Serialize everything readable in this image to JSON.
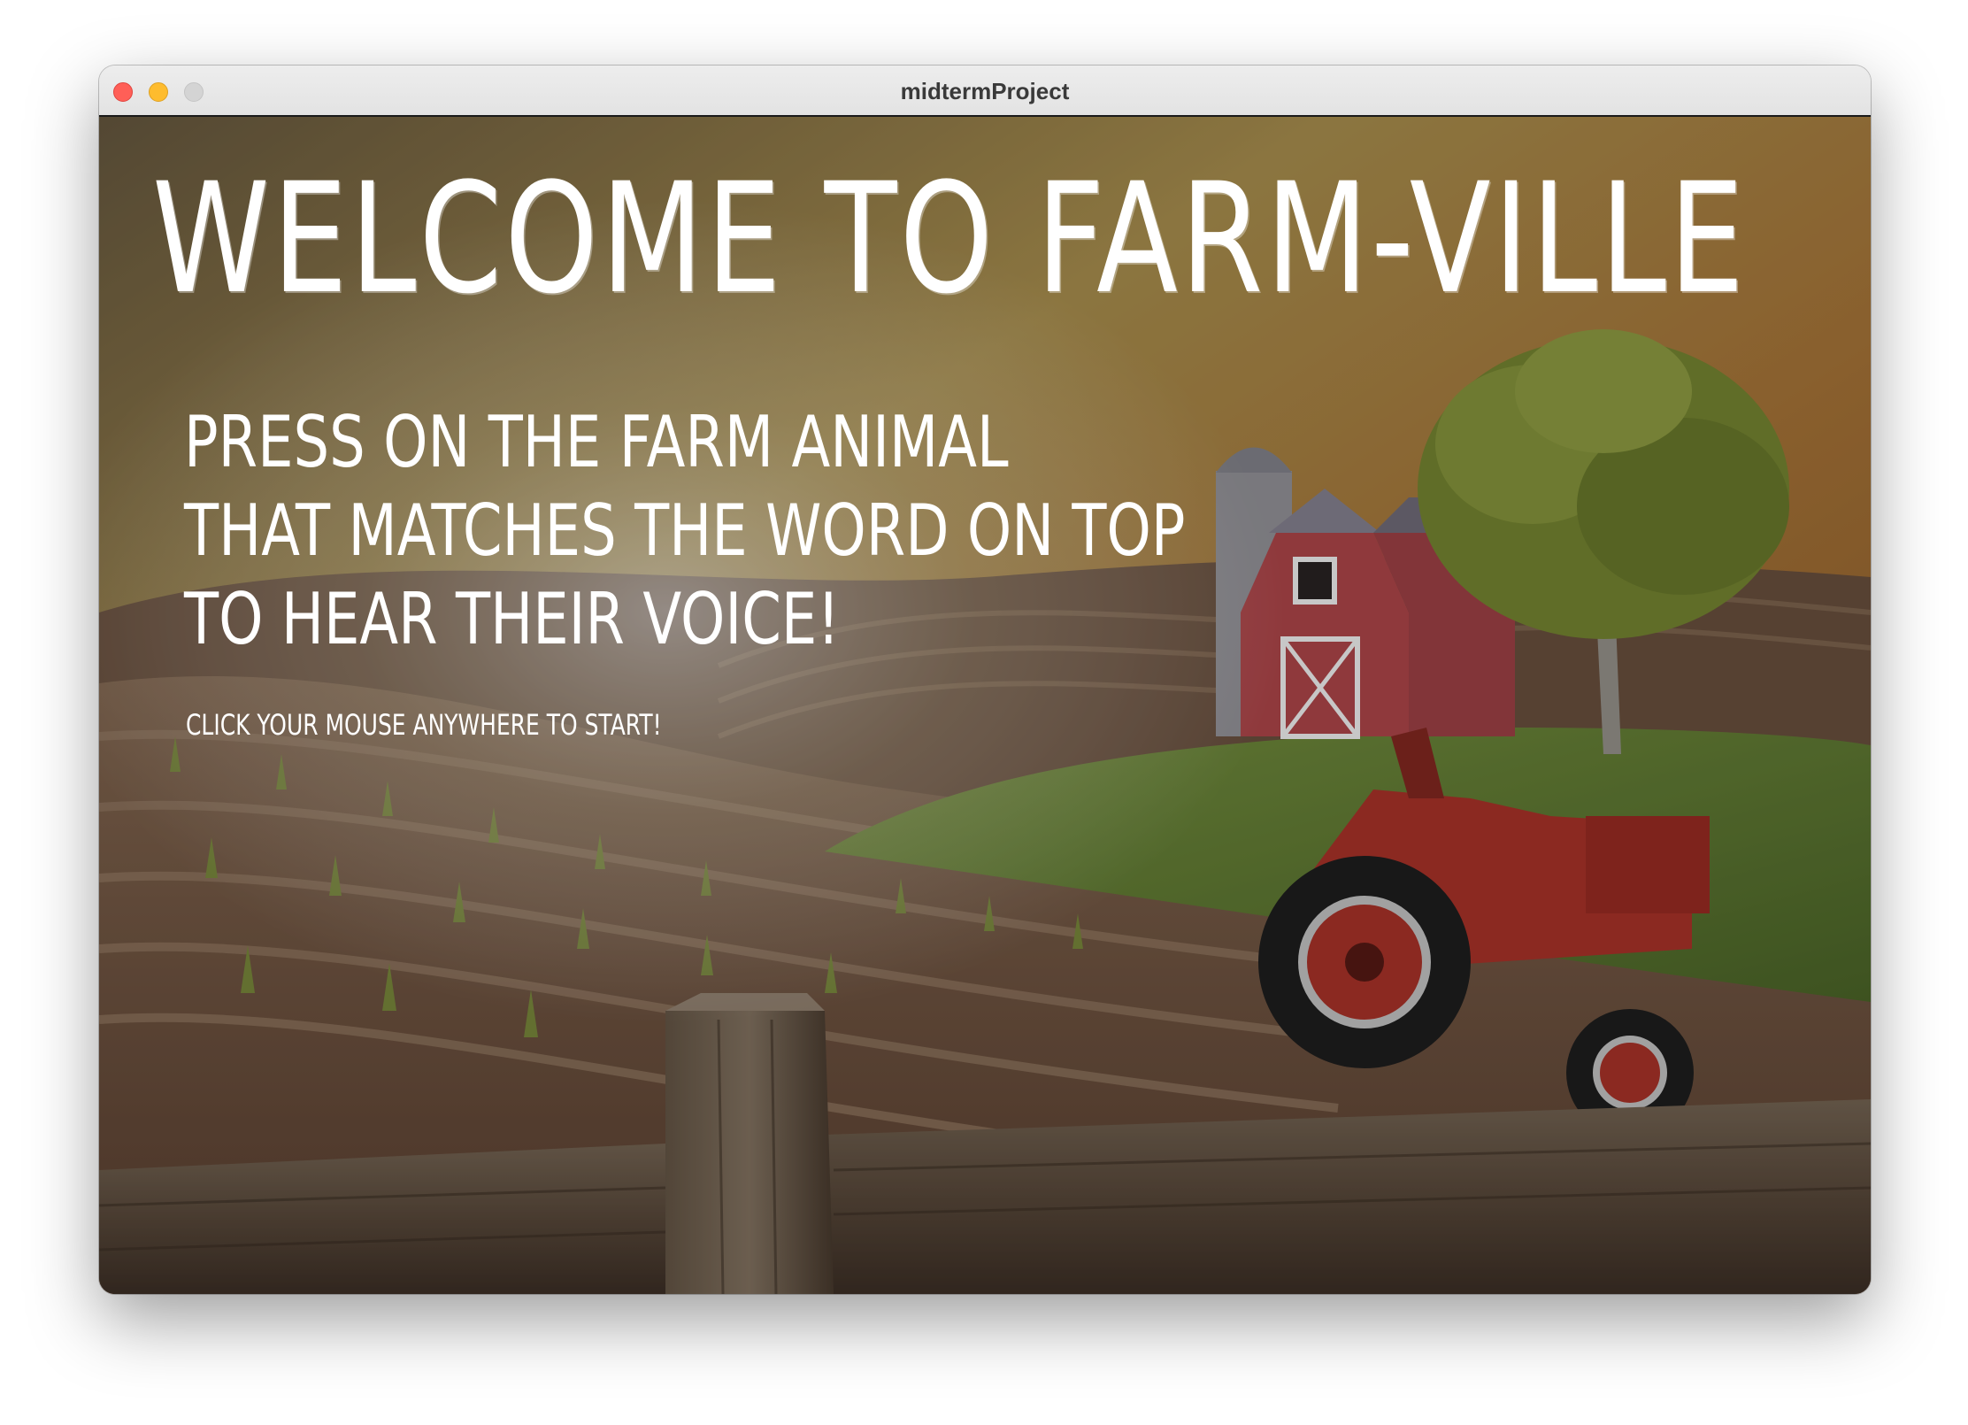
{
  "window": {
    "title": "midtermProject"
  },
  "scene": {
    "headline": "WELCOME TO FARM-VILLE",
    "instructions": [
      "PRESS ON THE FARM ANIMAL",
      "THAT MATCHES THE WORD ON TOP",
      "TO HEAR THEIR VOICE!"
    ],
    "start_hint": "CLICK YOUR MOUSE ANYWHERE TO START!"
  },
  "colors": {
    "sky_top": "#6d5a3f",
    "sky_glow": "#c9a45a",
    "field": "#7a5a45",
    "hill": "#6f8a35",
    "barn": "#b84a4e",
    "tractor": "#b3352b",
    "fence": "#6b5a4a",
    "text": "#ffffff"
  }
}
